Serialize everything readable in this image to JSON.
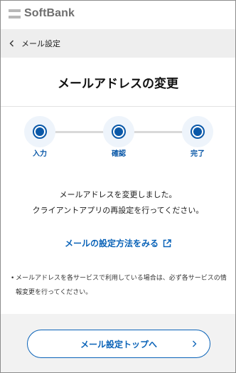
{
  "header": {
    "brand": "SoftBank"
  },
  "breadcrumb": {
    "label": "メール設定"
  },
  "page": {
    "title": "メールアドレスの変更"
  },
  "stepper": {
    "steps": [
      {
        "label": "入力"
      },
      {
        "label": "確認"
      },
      {
        "label": "完了"
      }
    ],
    "current_step": 3,
    "accent_color": "#0a58a8"
  },
  "message": {
    "line1": "メールアドレスを変更しました。",
    "line2": "クライアントアプリの再設定を行ってください。"
  },
  "setup_link": {
    "label": "メールの設定方法をみる",
    "icon": "external-link-icon"
  },
  "note": {
    "bullet": "•",
    "text": "メールアドレスを各サービスで利用している場合は、必ず各サービスの情報変更を行ってください。"
  },
  "footer": {
    "button_label": "メール設定トップへ"
  }
}
